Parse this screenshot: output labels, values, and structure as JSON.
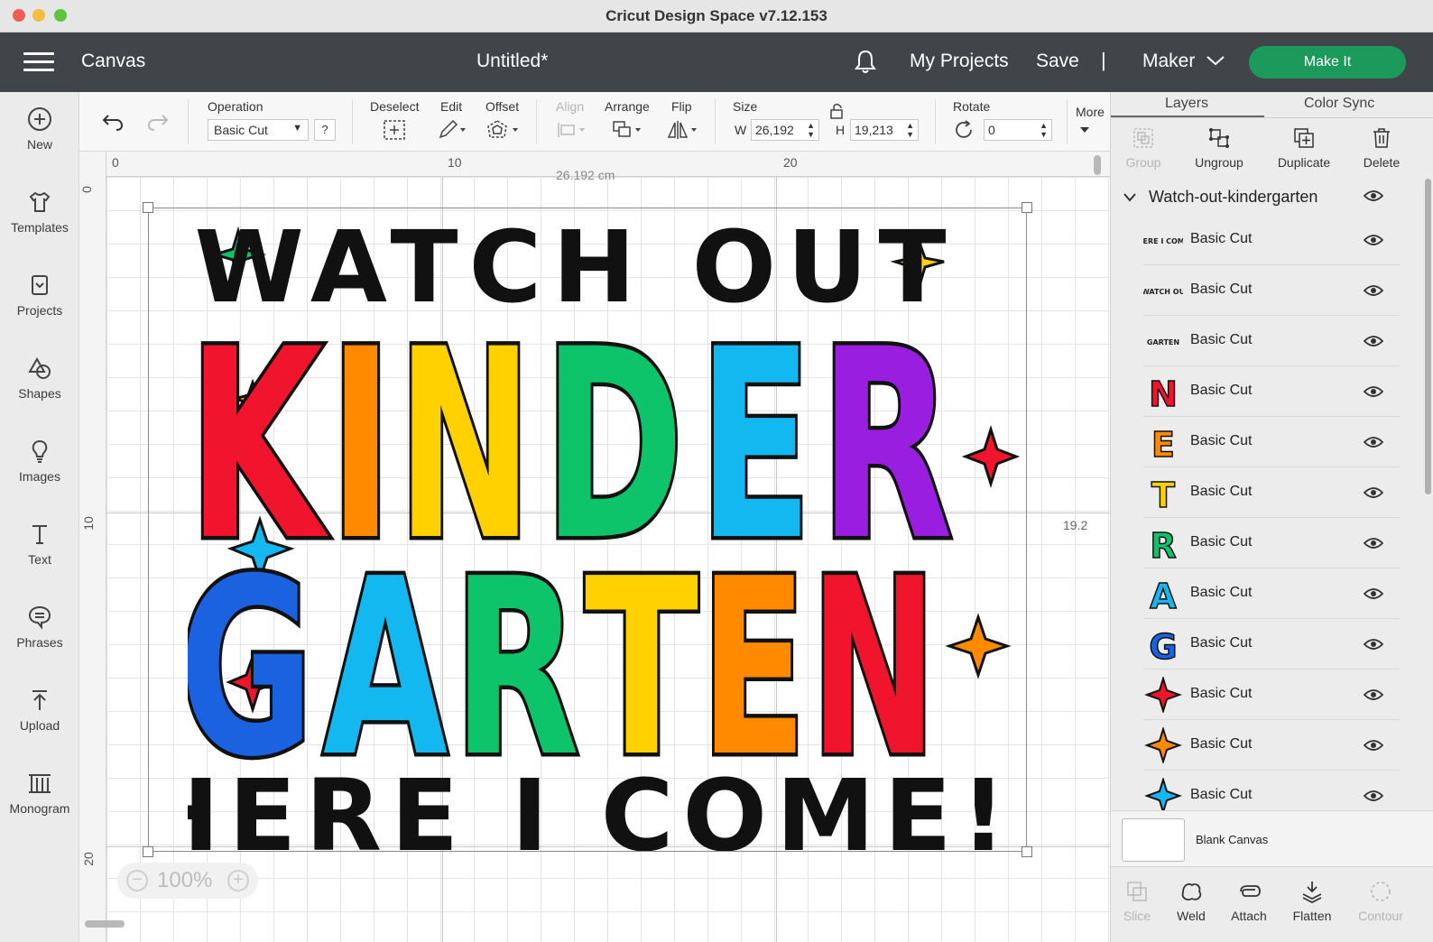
{
  "window": {
    "title": "Cricut Design Space  v7.12.153"
  },
  "header": {
    "section": "Canvas",
    "document": "Untitled*",
    "my_projects": "My Projects",
    "save": "Save",
    "separator": "|",
    "machine": "Maker",
    "make_it": "Make It",
    "accent": "#1c9a5c"
  },
  "sidebar": {
    "items": [
      {
        "label": "New",
        "icon": "plus-circle-icon"
      },
      {
        "label": "Templates",
        "icon": "tshirt-icon"
      },
      {
        "label": "Projects",
        "icon": "projects-icon"
      },
      {
        "label": "Shapes",
        "icon": "shapes-icon"
      },
      {
        "label": "Images",
        "icon": "lightbulb-icon"
      },
      {
        "label": "Text",
        "icon": "text-icon"
      },
      {
        "label": "Phrases",
        "icon": "speech-bubble-icon"
      },
      {
        "label": "Upload",
        "icon": "upload-icon"
      },
      {
        "label": "Monogram",
        "icon": "monogram-icon"
      }
    ]
  },
  "toolbar": {
    "operation_label": "Operation",
    "operation_value": "Basic Cut",
    "help": "?",
    "deselect": "Deselect",
    "edit": "Edit",
    "offset": "Offset",
    "align": "Align",
    "arrange": "Arrange",
    "flip": "Flip",
    "size": "Size",
    "w_label": "W",
    "w_value": "26,192",
    "h_label": "H",
    "h_value": "19,213",
    "rotate": "Rotate",
    "rotate_value": "0",
    "more": "More"
  },
  "canvas": {
    "ruler_top": [
      "0",
      "10",
      "20"
    ],
    "ruler_left": [
      "0",
      "10",
      "20"
    ],
    "width_dim": "26.192 cm",
    "height_dim": "19.2",
    "zoom": "100%",
    "zoom_minus": "−",
    "zoom_plus": "+",
    "artwork": {
      "line1": "WATCH OUT",
      "line2": [
        "K",
        "I",
        "N",
        "D",
        "E",
        "R"
      ],
      "line3": [
        "G",
        "A",
        "R",
        "T",
        "E",
        "N"
      ],
      "line4": "HERE I COME!"
    }
  },
  "panel": {
    "tabs": [
      "Layers",
      "Color Sync"
    ],
    "tools": [
      "Group",
      "Ungroup",
      "Duplicate",
      "Delete"
    ],
    "group_name": "Watch-out-kindergarten",
    "layers": [
      {
        "thumb": "HERE I COME",
        "name": "Basic Cut"
      },
      {
        "thumb": "WATCH OU",
        "name": "Basic Cut"
      },
      {
        "thumb": "GARTEN",
        "name": "Basic Cut"
      },
      {
        "thumb": "N",
        "name": "Basic Cut"
      },
      {
        "thumb": "E",
        "name": "Basic Cut"
      },
      {
        "thumb": "T",
        "name": "Basic Cut"
      },
      {
        "thumb": "R",
        "name": "Basic Cut"
      },
      {
        "thumb": "A",
        "name": "Basic Cut"
      },
      {
        "thumb": "G",
        "name": "Basic Cut"
      },
      {
        "thumb": "red-star",
        "name": "Basic Cut"
      },
      {
        "thumb": "orange-star",
        "name": "Basic Cut"
      },
      {
        "thumb": "blue-star",
        "name": "Basic Cut"
      }
    ],
    "blank_canvas": "Blank Canvas",
    "bottom_tools": [
      "Slice",
      "Weld",
      "Attach",
      "Flatten",
      "Contour"
    ]
  },
  "colors": {
    "red": "#f0142c",
    "orange": "#ff8a00",
    "yellow": "#ffd100",
    "green": "#0dc46a",
    "blue": "#14b8f0",
    "purple": "#9a1ee0",
    "royal": "#1a62e0"
  }
}
